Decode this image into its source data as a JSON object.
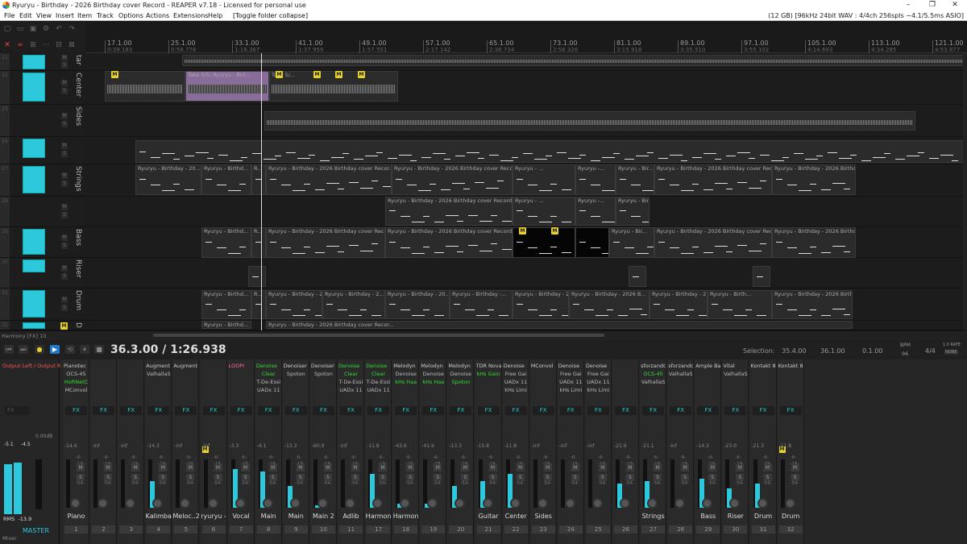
{
  "window": {
    "title": "Ryuryu - Birthday - 2026 Birthday cover Record - REAPER v7.18 - Licensed for personal use",
    "controls": [
      "–",
      "❐",
      "✕"
    ]
  },
  "menu": {
    "items": [
      "File",
      "Edit",
      "View",
      "Insert",
      "Item",
      "Track",
      "Options",
      "Actions",
      "Extensions",
      "Help",
      "[Toggle folder collapse]"
    ],
    "status": "(12 GB) [96kHz 24bit WAV : 4/4ch 256spls ~4.1/5.5ms ASIO]"
  },
  "ruler": [
    {
      "bar": "17.1.00",
      "time": "0:39.183"
    },
    {
      "bar": "25.1.00",
      "time": "0:58.776"
    },
    {
      "bar": "33.1.00",
      "time": "1:18.367"
    },
    {
      "bar": "41.1.00",
      "time": "1:37.959"
    },
    {
      "bar": "49.1.00",
      "time": "1:57.551"
    },
    {
      "bar": "57.1.00",
      "time": "2:17.142"
    },
    {
      "bar": "65.1.00",
      "time": "2:36.734"
    },
    {
      "bar": "73.1.00",
      "time": "2:56.326"
    },
    {
      "bar": "81.1.00",
      "time": "3:15.918"
    },
    {
      "bar": "89.1.00",
      "time": "3:35.510"
    },
    {
      "bar": "97.1.00",
      "time": "3:55.102"
    },
    {
      "bar": "105.1.00",
      "time": "4:14.693"
    },
    {
      "bar": "113.1.00",
      "time": "4:34.285"
    },
    {
      "bar": "121.1.00",
      "time": "4:53.877"
    }
  ],
  "tracks": [
    {
      "num": "21",
      "name": "tar"
    },
    {
      "num": "22",
      "name": "Center"
    },
    {
      "num": "23",
      "name": "Sides"
    },
    {
      "num": "26",
      "name": ""
    },
    {
      "num": "27",
      "name": "Strings"
    },
    {
      "num": "28",
      "name": ""
    },
    {
      "num": "29",
      "name": "Bass"
    },
    {
      "num": "30",
      "name": "Riser"
    },
    {
      "num": "31",
      "name": "Drum"
    },
    {
      "num": "32",
      "name": "D"
    }
  ],
  "items": {
    "take_label": "Take 5/5: Ryuryu - Birt...",
    "take_label_short": "Take 5/...",
    "record": "Ryuryu - Birthday - 2026 Birthday cover Recor...",
    "record_long": "Ryuryu - Birthday - 2026 Birthday cover Record_1...",
    "record_mid": "Ryuryu - Birthday - 2026 Birthda...",
    "short1": "Ryuryu - Birthday - 20...",
    "short2": "Ryuryu - Birthd...",
    "short3": "Ryuryu - ...",
    "short4": "Ryuryu -...",
    "short5": "Ryuryu - Bir...",
    "short6": "Ryuryu - Birthday - 2026 B...",
    "short7": "Ryuryu - Birthday - 20...",
    "short8": "Ryuryu - Birthday - 2...",
    "short9": "Ryuryu - Birthday -...",
    "short10": "Ryuryu - Birth...",
    "short11": "Ryuryu - Birthday - 2026 Birth...",
    "r": "R...",
    "m": "M"
  },
  "hscroll_label": "Harmony [FX] 10",
  "transport": {
    "time": "36.3.00 / 1:26.938",
    "selection_label": "Selection:",
    "sel_start": "35.4.00",
    "sel_end": "36.1.00",
    "sel_len": "0.1.00",
    "bpm_label": "BPM",
    "bpm": "96",
    "sig": "4/4",
    "rate": "1.0 RATE",
    "mode": "NONE"
  },
  "master": {
    "output": "Output Left / Output R",
    "peak_l": "-5.1",
    "peak_r": "-4.5",
    "gain": "0.00dB",
    "rms_label": "RMS",
    "rms": "-13.9",
    "name": "MASTER",
    "tab": "Mixer"
  },
  "strips": [
    {
      "name": "Piano",
      "num": "1",
      "io": "Pianotec",
      "fx": [
        "OCS-45",
        "HoRNetC",
        "MConvol"
      ],
      "fxg": [
        false,
        true,
        false
      ],
      "vol": "-14.6",
      "meter": 0.0
    },
    {
      "name": "",
      "num": "2",
      "io": "",
      "fx": [],
      "fxg": [],
      "vol": "-inf",
      "meter": 0.0
    },
    {
      "name": "",
      "num": "3",
      "io": "",
      "fx": [],
      "fxg": [],
      "vol": "-inf",
      "meter": 0.0
    },
    {
      "name": "Kalimba",
      "num": "4",
      "io": "Augment",
      "fx": [
        "ValhallaS"
      ],
      "fxg": [
        false
      ],
      "vol": "-14.3",
      "meter": 0.55
    },
    {
      "name": "Meloc..2",
      "num": "5",
      "io": "Augment",
      "fx": [],
      "fxg": [],
      "vol": "-inf",
      "meter": 0.0
    },
    {
      "name": "ryuryu -",
      "num": "6",
      "io": "",
      "fx": [],
      "fxg": [],
      "vol": "-inf",
      "meter": 0.0,
      "mbadge": true
    },
    {
      "name": "Vocal",
      "num": "7",
      "io": "LOOPI",
      "fx": [],
      "fxg": [],
      "vol": "-3.3",
      "meter": 0.8
    },
    {
      "name": "Main",
      "num": "8",
      "io": "Denoise",
      "fx": [
        "Clear",
        "T-De-Essi",
        "UADx 11"
      ],
      "fxg": [
        true,
        false,
        false
      ],
      "vol": "-4.1",
      "meter": 0.75
    },
    {
      "name": "Main",
      "num": "9",
      "io": "Denoiser",
      "fx": [
        "Spoton"
      ],
      "fxg": [
        false
      ],
      "vol": "-13.3",
      "meter": 0.45
    },
    {
      "name": "Main 2",
      "num": "10",
      "io": "Denoiser",
      "fx": [
        "Spoton"
      ],
      "fxg": [
        false
      ],
      "vol": "-60.9",
      "meter": 0.05
    },
    {
      "name": "Adlib",
      "num": "11",
      "io": "Denoise",
      "fx": [
        "Clear",
        "T-De-Essi",
        "UADx 11"
      ],
      "fxg": [
        true,
        false,
        false
      ],
      "vol": "-inf",
      "meter": 0.0
    },
    {
      "name": "Harmon",
      "num": "17",
      "io": "Denoise",
      "fx": [
        "Clear",
        "T-De-Essi",
        "UADx 11"
      ],
      "fxg": [
        true,
        false,
        false
      ],
      "vol": "-11.8",
      "meter": 0.7
    },
    {
      "name": "Harmon",
      "num": "18",
      "io": "Melodyn",
      "fx": [
        "Denoise",
        "kHs Haa"
      ],
      "fxg": [
        false,
        true
      ],
      "vol": "-43.6",
      "meter": 0.08
    },
    {
      "name": "",
      "num": "19",
      "io": "Melodyn",
      "fx": [
        "Denoise",
        "kHs Haa"
      ],
      "fxg": [
        false,
        true
      ],
      "vol": "-41.9",
      "meter": 0.08
    },
    {
      "name": "",
      "num": "20",
      "io": "Melodyn",
      "fx": [
        "Denoise",
        "Spoton"
      ],
      "fxg": [
        false,
        true
      ],
      "vol": "-13.3",
      "meter": 0.45
    },
    {
      "name": "Guitar",
      "num": "21",
      "io": "TDR Nova",
      "fx": [
        "kHs Gain"
      ],
      "fxg": [
        true
      ],
      "vol": "-15.8",
      "meter": 0.55
    },
    {
      "name": "Center",
      "num": "22",
      "io": "Denoise",
      "fx": [
        "Free Gai",
        "UADx 11",
        "kHs Limi"
      ],
      "fxg": [
        false,
        false,
        false
      ],
      "vol": "-11.8",
      "meter": 0.7
    },
    {
      "name": "Sides",
      "num": "23",
      "io": "MConvol",
      "fx": [],
      "fxg": [],
      "vol": "-inf",
      "meter": 0.0
    },
    {
      "name": "",
      "num": "24",
      "io": "Denoise",
      "fx": [
        "Free Gai",
        "UADx 11",
        "kHs Limi"
      ],
      "fxg": [
        false,
        false,
        false
      ],
      "vol": "-inf",
      "meter": 0.0
    },
    {
      "name": "",
      "num": "25",
      "io": "Denoise",
      "fx": [
        "Free Gai",
        "UADx 11",
        "kHs Limi"
      ],
      "fxg": [
        false,
        false,
        false
      ],
      "vol": "-inf",
      "meter": 0.0
    },
    {
      "name": "",
      "num": "26",
      "io": "",
      "fx": [],
      "fxg": [],
      "vol": "-21.6",
      "meter": 0.5
    },
    {
      "name": "Strings",
      "num": "27",
      "io": "sforzandc",
      "fx": [
        "OCS-45",
        "ValhallaS"
      ],
      "fxg": [
        true,
        false
      ],
      "vol": "-21.1",
      "meter": 0.55
    },
    {
      "name": "",
      "num": "28",
      "io": "sforzandc",
      "fx": [
        "ValhallaS"
      ],
      "fxg": [
        false
      ],
      "vol": "-inf",
      "meter": 0.0
    },
    {
      "name": "Bass",
      "num": "29",
      "io": "Ample Ba",
      "fx": [],
      "fxg": [],
      "vol": "-14.3",
      "meter": 0.6
    },
    {
      "name": "Riser",
      "num": "30",
      "io": "Vital",
      "fx": [
        "ValhallaS"
      ],
      "fxg": [
        false
      ],
      "vol": "-23.0",
      "meter": 0.4
    },
    {
      "name": "Drum",
      "num": "31",
      "io": "Kontakt 8",
      "fx": [],
      "fxg": [],
      "vol": "-21.3",
      "meter": 0.5
    },
    {
      "name": "Drum",
      "num": "32",
      "io": "Kontakt 8",
      "fx": [],
      "fxg": [],
      "vol": "-11.8",
      "meter": 0.0,
      "mbadge": true
    }
  ],
  "labels": {
    "fx": "FX",
    "m": "M",
    "s": "S",
    "scale": [
      "-6-",
      "-18-",
      "-30-",
      "-42-",
      "-54-"
    ]
  },
  "colors": {
    "meter": "#2ec8dc",
    "badge": "#e6d12a",
    "fxgreen": "#33dd33",
    "master_out": "#ff5555"
  }
}
